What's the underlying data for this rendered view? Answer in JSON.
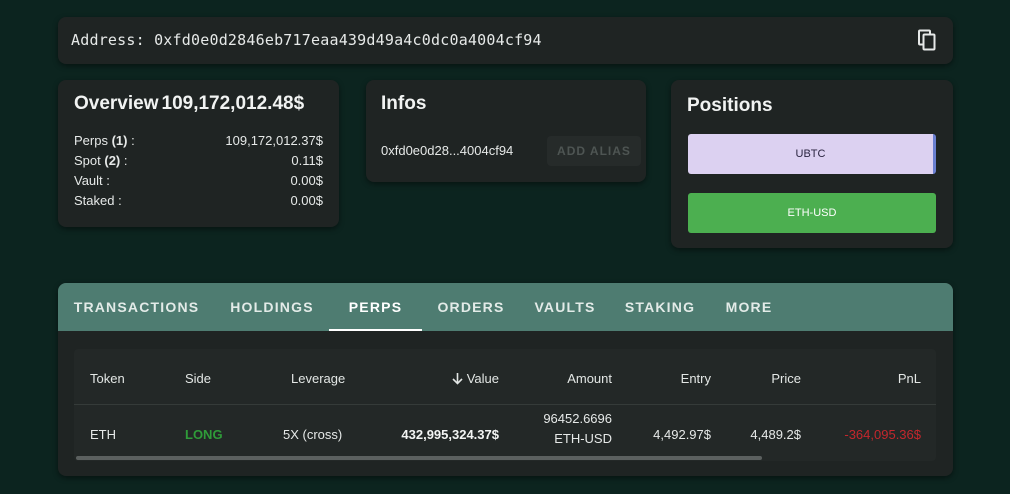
{
  "address": {
    "label": "Address: 0xfd0e0d2846eb717eaa439d49a4c0dc0a4004cf94",
    "copy_icon": "copy-icon"
  },
  "overview": {
    "title": "Overview",
    "total": "109,172,012.48$",
    "rows": [
      {
        "label": "Perps",
        "count": "(1)",
        "suffix": " :",
        "value": "109,172,012.37$"
      },
      {
        "label": "Spot",
        "count": "(2)",
        "suffix": " :",
        "value": "0.11$"
      },
      {
        "label": "Vault :",
        "count": "",
        "suffix": "",
        "value": "0.00$"
      },
      {
        "label": "Staked :",
        "count": "",
        "suffix": "",
        "value": "0.00$"
      }
    ]
  },
  "infos": {
    "title": "Infos",
    "short_address": "0xfd0e0d28...4004cf94",
    "alias_button": "ADD ALIAS"
  },
  "positions": {
    "title": "Positions",
    "items": [
      "UBTC",
      "ETH-USD"
    ]
  },
  "tabs": [
    "TRANSACTIONS",
    "HOLDINGS",
    "PERPS",
    "ORDERS",
    "VAULTS",
    "STAKING",
    "MORE"
  ],
  "active_tab": "PERPS",
  "table": {
    "headers": [
      "Token",
      "Side",
      "Leverage",
      "Value",
      "Amount",
      "Entry",
      "Price",
      "PnL"
    ],
    "sort_icon": "arrow-down-icon",
    "rows": [
      {
        "token": "ETH",
        "side": "LONG",
        "leverage": "5X (cross)",
        "value": "432,995,324.37$",
        "amount_line1": "96452.6696",
        "amount_line2": "ETH-USD",
        "entry": "4,492.97$",
        "price": "4,489.2$",
        "pnl": "-364,095.36$"
      }
    ]
  },
  "colors": {
    "background": "#0c241f",
    "card": "#1f2423",
    "tab_bar": "#4e7c71",
    "long": "#2f9c39",
    "pnl_negative": "#c4272d",
    "ubtc": "#dcd1f1",
    "eth_usd": "#4caf50"
  }
}
